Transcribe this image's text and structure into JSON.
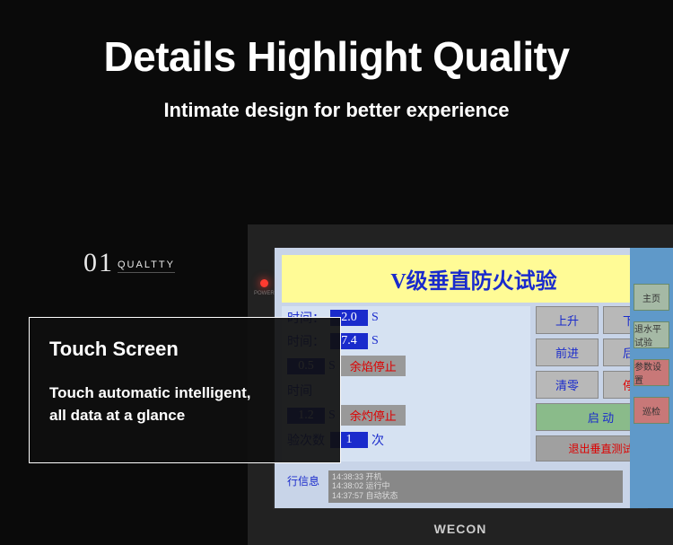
{
  "header": {
    "title": "Details Highlight Quality",
    "subtitle": "Intimate design for better experience"
  },
  "overlay": {
    "number": "01",
    "tag": "QUALTTY",
    "title": "Touch Screen",
    "description_line1": "Touch automatic intelligent,",
    "description_line2": "all data at a glance"
  },
  "hmi": {
    "brand": "WECON",
    "power_label": "POWER",
    "screen_title": "V级垂直防火试验",
    "params": [
      {
        "label": "时间：",
        "value": "2.0",
        "unit": "S"
      },
      {
        "label": "时间：",
        "value": "7.4",
        "unit": "S"
      }
    ],
    "halt1": {
      "label": "余焰停止",
      "prefix_value": "0.5",
      "prefix_unit": "S"
    },
    "halt2_label": "时间",
    "halt2": {
      "label": "余灼停止",
      "prefix_value": "1.2",
      "prefix_unit": "S"
    },
    "count_row": {
      "label": "验次数",
      "value": "1",
      "unit": "次"
    },
    "buttons": {
      "up": "上升",
      "down": "下降",
      "forward": "前进",
      "back": "后退",
      "clear": "清零",
      "stop": "停止",
      "start": "启 动",
      "exit": "退出垂直测试"
    },
    "side": {
      "home": "主页",
      "horiz": "退水平试验",
      "param": "参数设置",
      "extra": "巡检"
    },
    "footer": {
      "label": "行信息",
      "log1": "14:38:33 开机",
      "log2": "14:38:02 运行中",
      "log3": "14:37:57 自动状态"
    }
  }
}
